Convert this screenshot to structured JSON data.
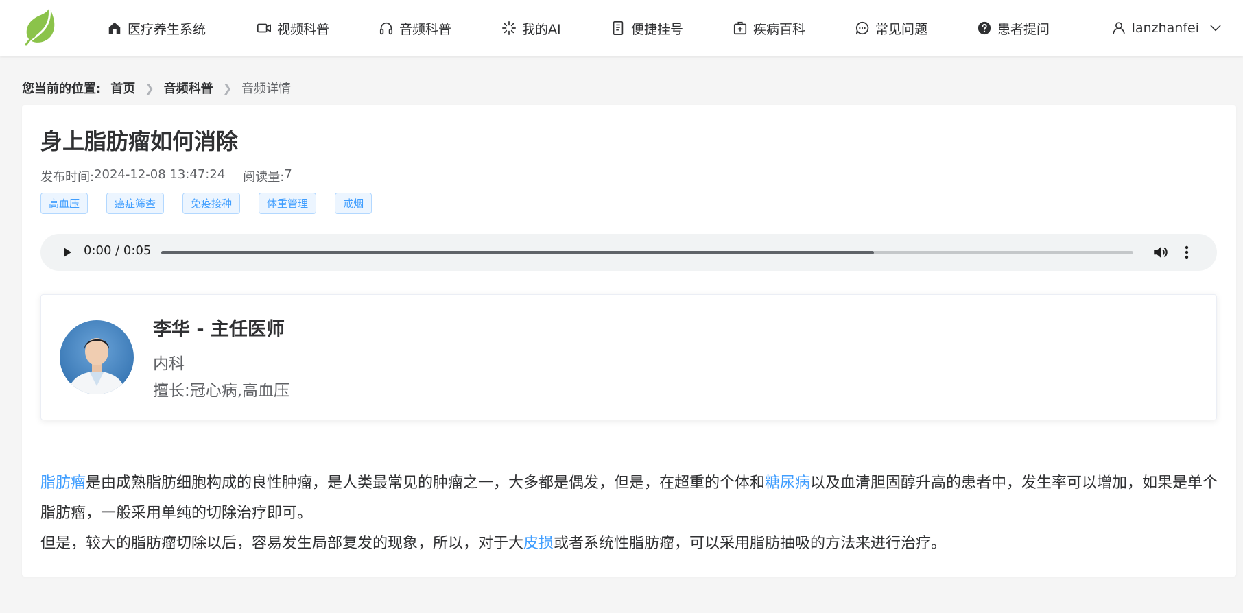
{
  "header": {
    "nav": [
      {
        "label": "医疗养生系统",
        "icon": "home-icon"
      },
      {
        "label": "视频科普",
        "icon": "video-icon"
      },
      {
        "label": "音频科普",
        "icon": "headphones-icon"
      },
      {
        "label": "我的AI",
        "icon": "loading-sparkle-icon"
      },
      {
        "label": "便捷挂号",
        "icon": "document-icon"
      },
      {
        "label": "疾病百科",
        "icon": "medical-box-icon"
      },
      {
        "label": "常见问题",
        "icon": "chat-bubble-icon"
      },
      {
        "label": "患者提问",
        "icon": "question-circle-icon"
      }
    ],
    "user": {
      "name": "lanzhanfei"
    }
  },
  "breadcrumb": {
    "label": "您当前的位置:",
    "items": [
      "首页",
      "音频科普"
    ],
    "current": "音频详情"
  },
  "article": {
    "title": "身上脂肪瘤如何消除",
    "publish_label": "发布时间:",
    "publish_time": "2024-12-08 13:47:24",
    "views_label": "阅读量:",
    "views": "7",
    "tags": [
      "高血压",
      "癌症筛查",
      "免疫接种",
      "体重管理",
      "戒烟"
    ]
  },
  "audio": {
    "time": "0:00 / 0:05",
    "buffered": 0.733
  },
  "doctor": {
    "name": "李华 - 主任医师",
    "department": "内科",
    "specialty_label": "擅长:",
    "specialty": "冠心病,高血压"
  },
  "content": {
    "p1": [
      {
        "text": "脂肪瘤",
        "link": true
      },
      {
        "text": "是由成熟脂肪细胞构成的良性肿瘤，是人类最常见的肿瘤之一，大多都是偶发，但是，在超重的个体和",
        "link": false
      },
      {
        "text": "糖尿病",
        "link": true
      },
      {
        "text": "以及血清胆固醇升高的患者中，发生率可以增加，如果是单个脂肪瘤，一般采用单纯的切除治疗即可。",
        "link": false
      }
    ],
    "p2": [
      {
        "text": "但是，较大的脂肪瘤切除以后，容易发生局部复发的现象，所以，对于大",
        "link": false
      },
      {
        "text": "皮损",
        "link": true
      },
      {
        "text": "或者系统性脂肪瘤，可以采用脂肪抽吸的方法来进行治疗。",
        "link": false
      }
    ]
  },
  "colors": {
    "accent": "#409eff",
    "logo_green": "#8bc34a"
  }
}
